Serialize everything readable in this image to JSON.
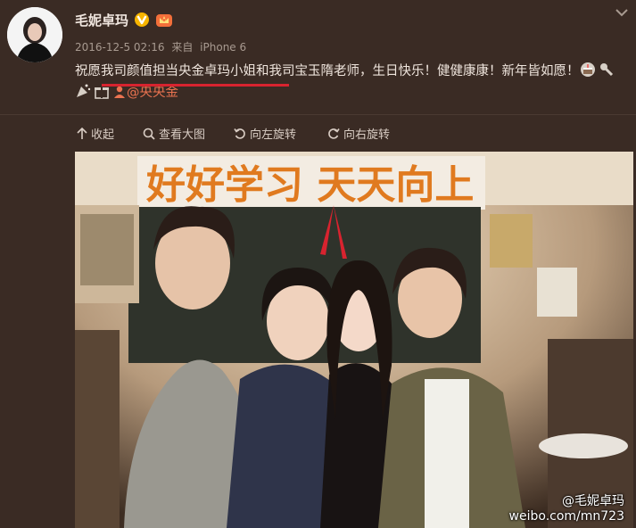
{
  "user": {
    "name": "毛妮卓玛"
  },
  "meta": {
    "timestamp": "2016-12-5 02:16",
    "source_prefix": "来自",
    "source_device": "iPhone 6"
  },
  "post": {
    "text_1": "祝愿",
    "text_underlined": "我司颜值担当央金卓玛小姐",
    "text_2": "和我司宝玉隋老师，生日快乐！健健康康！新年皆如愿！",
    "mention": "@央央金"
  },
  "toolbar": {
    "collect": "收起",
    "view_large": "查看大图",
    "rotate_left": "向左旋转",
    "rotate_right": "向右旋转"
  },
  "photo": {
    "banner_text": "好好学习 天天向上",
    "watermark_user": "@毛妮卓玛",
    "watermark_url": "weibo.com/mn723"
  },
  "icons": {
    "verified": "verified-v-icon",
    "member": "crown-member-icon",
    "collapse": "chevron-down-icon",
    "collect": "arrow-up-icon",
    "view_large": "magnifier-icon",
    "rotate_left": "rotate-left-icon",
    "rotate_right": "rotate-right-icon"
  },
  "colors": {
    "background": "#3a2b24",
    "mention": "#eb7350",
    "underline": "#d8232f",
    "verified": "#f7b500"
  }
}
